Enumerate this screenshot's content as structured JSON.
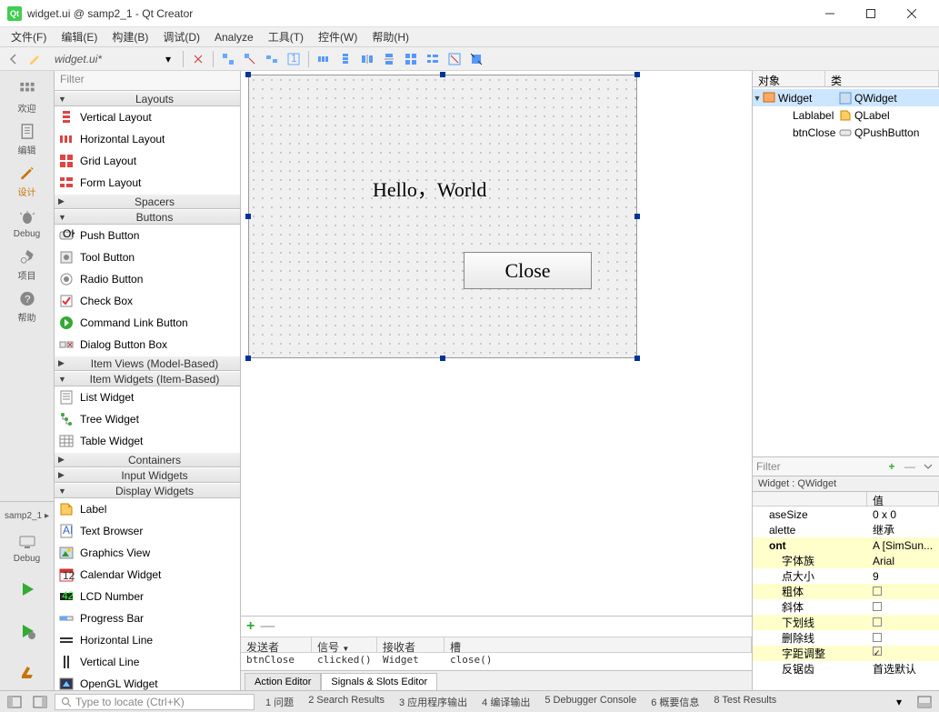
{
  "window": {
    "title": "widget.ui @ samp2_1 - Qt Creator"
  },
  "menu": {
    "items": [
      "文件(F)",
      "编辑(E)",
      "构建(B)",
      "调试(D)",
      "Analyze",
      "工具(T)",
      "控件(W)",
      "帮助(H)"
    ]
  },
  "toolbar": {
    "docLabel": "widget.ui*"
  },
  "leftbar": {
    "items": [
      {
        "key": "welcome",
        "label": "欢迎"
      },
      {
        "key": "edit",
        "label": "编辑"
      },
      {
        "key": "design",
        "label": "设计",
        "active": true
      },
      {
        "key": "debug",
        "label": "Debug"
      },
      {
        "key": "projects",
        "label": "项目"
      },
      {
        "key": "help",
        "label": "帮助"
      }
    ],
    "project": "samp2_1",
    "debugLabel": "Debug"
  },
  "widgetbox": {
    "filter": "Filter",
    "groups": [
      {
        "name": "Layouts",
        "expanded": true,
        "items": [
          "Vertical Layout",
          "Horizontal Layout",
          "Grid Layout",
          "Form Layout"
        ]
      },
      {
        "name": "Spacers",
        "expanded": false,
        "items": []
      },
      {
        "name": "Buttons",
        "expanded": true,
        "items": [
          "Push Button",
          "Tool Button",
          "Radio Button",
          "Check Box",
          "Command Link Button",
          "Dialog Button Box"
        ]
      },
      {
        "name": "Item Views (Model-Based)",
        "expanded": false,
        "items": []
      },
      {
        "name": "Item Widgets (Item-Based)",
        "expanded": true,
        "items": [
          "List Widget",
          "Tree Widget",
          "Table Widget"
        ]
      },
      {
        "name": "Containers",
        "expanded": false,
        "items": []
      },
      {
        "name": "Input Widgets",
        "expanded": false,
        "items": []
      },
      {
        "name": "Display Widgets",
        "expanded": true,
        "items": [
          "Label",
          "Text Browser",
          "Graphics View",
          "Calendar Widget",
          "LCD Number",
          "Progress Bar",
          "Horizontal Line",
          "Vertical Line",
          "OpenGL Widget"
        ]
      }
    ]
  },
  "form": {
    "labelText": "Hello，World",
    "buttonText": "Close"
  },
  "signalsTable": {
    "headers": [
      "发送者",
      "信号",
      "接收者",
      "槽"
    ],
    "row": {
      "sender": "btnClose",
      "signal": "clicked()",
      "receiver": "Widget",
      "slot": "close()"
    }
  },
  "bottomTabs": {
    "action": "Action Editor",
    "signals": "Signals & Slots Editor"
  },
  "objectInspector": {
    "headers": [
      "对象",
      "类"
    ],
    "rows": [
      {
        "name": "Widget",
        "cls": "QWidget",
        "level": 0,
        "selected": true
      },
      {
        "name": "Lablabel",
        "cls": "QLabel",
        "level": 1
      },
      {
        "name": "btnClose",
        "cls": "QPushButton",
        "level": 1
      }
    ]
  },
  "propFilter": {
    "placeholder": "Filter"
  },
  "propBreadcrumb": "Widget : QWidget",
  "propHeaders": {
    "value": "值"
  },
  "properties": [
    {
      "name": "aseSize",
      "value": "0 x 0",
      "hl": false
    },
    {
      "name": "alette",
      "value": "继承",
      "hl": false
    },
    {
      "name": "ont",
      "value": "A  [SimSun...",
      "hl": true,
      "bold": true
    },
    {
      "name": "字体族",
      "value": "Arial",
      "hl": true,
      "sub": true
    },
    {
      "name": "点大小",
      "value": "9",
      "hl": false,
      "sub": true
    },
    {
      "name": "粗体",
      "check": false,
      "hl": true,
      "sub": true
    },
    {
      "name": "斜体",
      "check": false,
      "hl": false,
      "sub": true
    },
    {
      "name": "下划线",
      "check": false,
      "hl": true,
      "sub": true
    },
    {
      "name": "删除线",
      "check": false,
      "hl": false,
      "sub": true
    },
    {
      "name": "字距调整",
      "check": true,
      "hl": true,
      "sub": true
    },
    {
      "name": "反锯齿",
      "value": "首选默认",
      "hl": false,
      "sub": true
    }
  ],
  "statusbar": {
    "searchPlaceholder": "Type to locate (Ctrl+K)",
    "panes": [
      "1  问题",
      "2  Search Results",
      "3  应用程序输出",
      "4  编译输出",
      "5  Debugger Console",
      "6  概要信息",
      "8  Test Results"
    ]
  }
}
